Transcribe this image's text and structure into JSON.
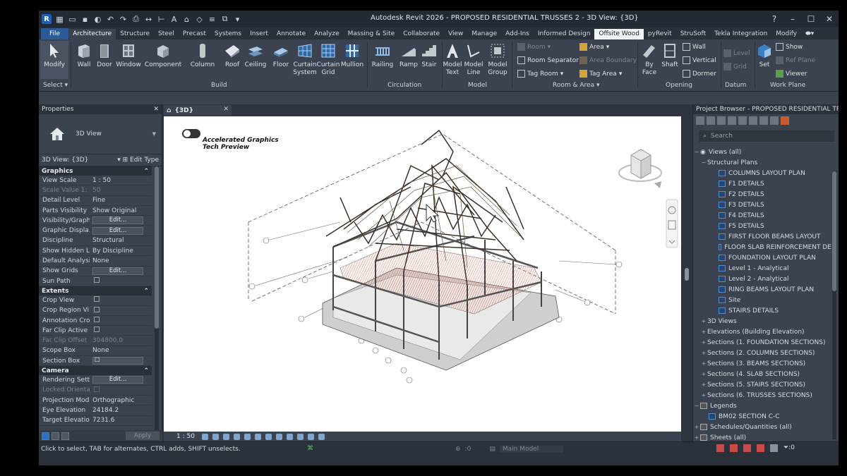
{
  "window": {
    "title": "Autodesk Revit 2026 - PROPOSED RESIDENTIAL TRUSSES 2 - 3D View: {3D}"
  },
  "tabs": [
    "File",
    "Architecture",
    "Structure",
    "Steel",
    "Precast",
    "Systems",
    "Insert",
    "Annotate",
    "Analyze",
    "Massing & Site",
    "Collaborate",
    "View",
    "Manage",
    "Add-Ins",
    "Informed Design",
    "Offsite Wood",
    "pyRevit",
    "StruSoft",
    "Tekla Integration",
    "Modify"
  ],
  "ribbon": {
    "select": {
      "modify": "Modify",
      "select": "Select"
    },
    "build": {
      "wall": "Wall",
      "door": "Door",
      "window": "Window",
      "component": "Component",
      "column": "Column",
      "roof": "Roof",
      "ceiling": "Ceiling",
      "floor": "Floor",
      "curtain_system": "Curtain\nSystem",
      "curtain_grid": "Curtain\nGrid",
      "mullion": "Mullion",
      "panel": "Build"
    },
    "circulation": {
      "railing": "Railing",
      "ramp": "Ramp",
      "stair": "Stair",
      "panel": "Circulation"
    },
    "model": {
      "model_text": "Model\nText",
      "model_line": "Model\nLine",
      "model_group": "Model\nGroup",
      "panel": "Model"
    },
    "room_area": {
      "room": "Room",
      "room_separator": "Room Separator",
      "tag_room": "Tag  Room",
      "area": "Area",
      "area_boundary": "Area  Boundary",
      "tag_area": "Tag  Area",
      "panel": "Room & Area"
    },
    "opening": {
      "by_face": "By\nFace",
      "shaft": "Shaft",
      "wall": "Wall",
      "vertical": "Vertical",
      "dormer": "Dormer",
      "panel": "Opening"
    },
    "datum": {
      "level": "Level",
      "grid": "Grid",
      "panel": "Datum"
    },
    "work_plane": {
      "set": "Set",
      "show": "Show",
      "ref_plane": "Ref  Plane",
      "viewer": "Viewer",
      "panel": "Work Plane"
    }
  },
  "properties": {
    "title": "Properties",
    "type_name": "3D View",
    "instance": "3D View: {3D}",
    "edit_type": "Edit Type",
    "graphics": {
      "title": "Graphics",
      "rows": [
        [
          "View Scale",
          "1 : 50"
        ],
        [
          "Scale Value    1:",
          "50"
        ],
        [
          "Detail Level",
          "Fine"
        ],
        [
          "Parts Visibility",
          "Show Original"
        ],
        [
          "Visibility/Graph...",
          "Edit..."
        ],
        [
          "Graphic Displa...",
          "Edit..."
        ],
        [
          "Discipline",
          "Structural"
        ],
        [
          "Show Hidden L...",
          "By Discipline"
        ],
        [
          "Default Analysi...",
          "None"
        ],
        [
          "Show Grids",
          "Edit..."
        ],
        [
          "Sun Path",
          ""
        ]
      ]
    },
    "extents": {
      "title": "Extents",
      "rows": [
        [
          "Crop View",
          ""
        ],
        [
          "Crop Region Vi...",
          ""
        ],
        [
          "Annotation Crop",
          ""
        ],
        [
          "Far Clip Active",
          ""
        ],
        [
          "Far Clip Offset",
          "304800.0"
        ],
        [
          "Scope Box",
          "None"
        ],
        [
          "Section Box",
          ""
        ]
      ]
    },
    "camera": {
      "title": "Camera",
      "rows": [
        [
          "Rendering Setti...",
          "Edit..."
        ],
        [
          "Locked Orienta...",
          ""
        ],
        [
          "Projection Mode",
          "Orthographic"
        ],
        [
          "Eye Elevation",
          "24184.2"
        ],
        [
          "Target Elevation",
          "7231.6"
        ]
      ]
    },
    "apply": "Apply"
  },
  "view": {
    "tab": "{3D}",
    "toggle_title": "Accelerated Graphics",
    "toggle_sub": "Tech Preview",
    "scale": "1 : 50"
  },
  "browser": {
    "title": "Project Browser - PROPOSED RESIDENTIAL TR...",
    "search": "Search",
    "views_all": "Views (all)",
    "structural_plans": "Structural Plans",
    "plans": [
      "COLUMNS LAYOUT PLAN",
      "F1 DETAILS",
      "F2 DETAILS",
      "F3 DETAILS",
      "F4 DETAILS",
      "F5 DETAILS",
      "FIRST FLOOR BEAMS LAYOUT",
      "FLOOR SLAB REINFORCEMENT DE",
      "FOUNDATION LAYOUT PLAN",
      "Level 1 - Analytical",
      "Level 2 - Analytical",
      "RING BEAMS LAYOUT PLAN",
      "Site",
      "STAIRS DETAILS"
    ],
    "groups": [
      "3D Views",
      "Elevations (Building Elevation)",
      "Sections (1. FOUNDATION SECTIONS)",
      "Sections (2. COLUMNS SECTIONS)",
      "Sections (3. BEAMS SECTIONS)",
      "Sections (4. SLAB SECTIONS)",
      "Sections (5. STAIRS SECTIONS)",
      "Sections (6. TRUSSES SECTIONS)"
    ],
    "legends": "Legends",
    "legend_item": "BM02 SECTION C-C",
    "schedules": "Schedules/Quantities (all)",
    "sheets": "Sheets (all)"
  },
  "status": {
    "message": "Click to select, TAB for alternates, CTRL adds, SHIFT unselects.",
    "count_a": ":0",
    "model": "Main Model",
    "count_b": ":0"
  },
  "colors": {
    "accent": "#2c5a96",
    "ribbon": "#3b4350",
    "canvas": "#ffffff",
    "truss": "#3a2f24",
    "hatch": "#e4553a"
  }
}
